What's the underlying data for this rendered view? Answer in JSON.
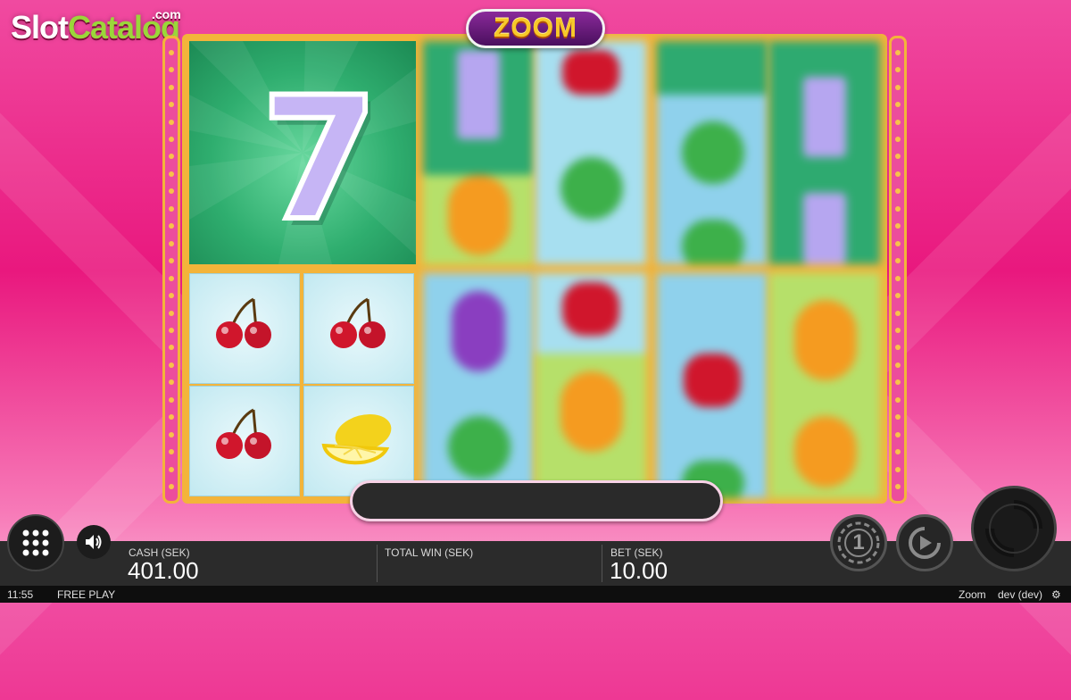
{
  "brand": {
    "logo_part1": "Slot",
    "logo_part2": "Catalog",
    "logo_suffix": ".com"
  },
  "game": {
    "title": "ZOOM"
  },
  "colors": {
    "background": "#e9187e",
    "frame": "#f3b43a",
    "title_text": "#f7c92a"
  },
  "reels": {
    "big_symbol": "seven",
    "small_grid": [
      "cherry",
      "cherry",
      "cherry",
      "lemon"
    ],
    "spinning_columns": [
      [
        "seven",
        "orange"
      ],
      [
        "cherry",
        "watermelon"
      ],
      [
        "watermelon",
        "watermelon"
      ],
      [
        "seven",
        "seven"
      ],
      [
        "grapes",
        "watermelon"
      ],
      [
        "cherry",
        "orange"
      ],
      [
        "cherry",
        "watermelon"
      ],
      [
        "orange",
        "orange"
      ]
    ]
  },
  "bottom_bar": {
    "cash_label": "CASH (SEK)",
    "cash_value": "401.00",
    "total_win_label": "TOTAL WIN (SEK)",
    "total_win_value": "",
    "bet_label": "BET (SEK)",
    "bet_value": "10.00"
  },
  "buttons": {
    "menu_icon": "grid-icon",
    "sound_icon": "speaker-icon",
    "coin_value": "1",
    "autoplay_icon": "autoplay-icon",
    "spin_icon": "spin-icon"
  },
  "status_bar": {
    "time": "11:55",
    "mode": "FREE PLAY",
    "game_name": "Zoom",
    "user": "dev (dev)"
  }
}
